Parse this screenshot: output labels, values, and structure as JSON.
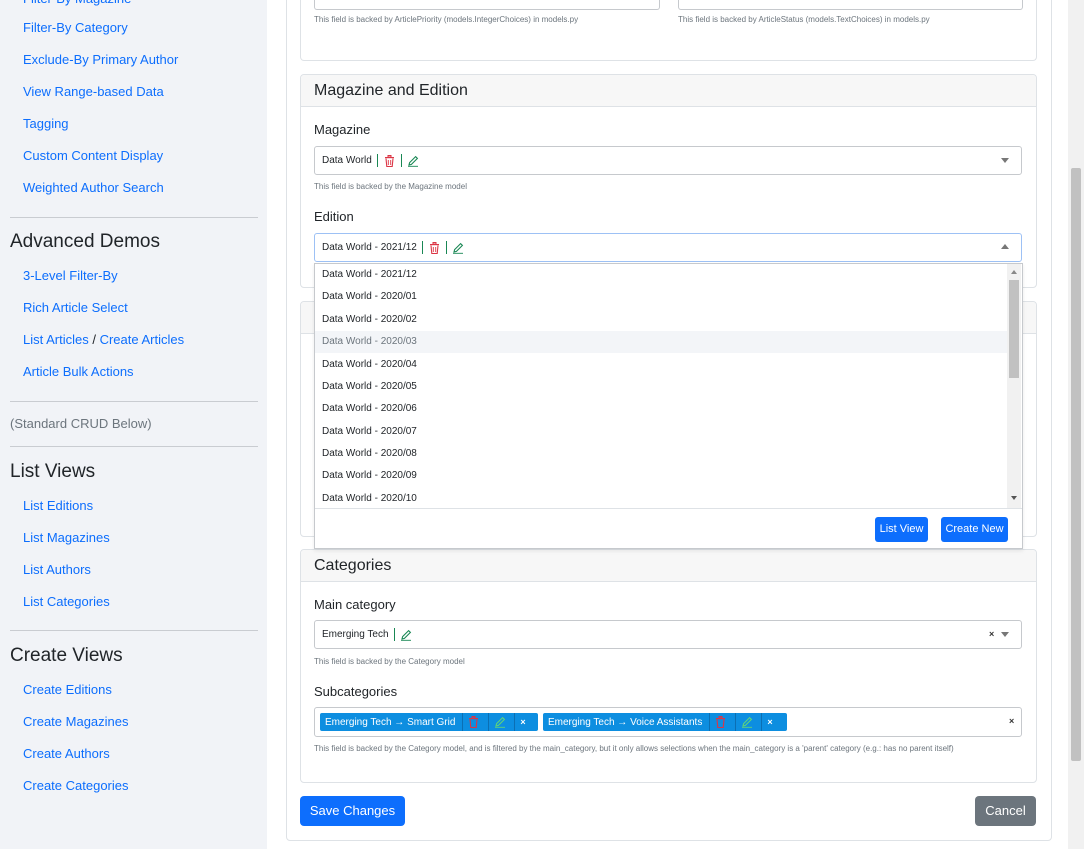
{
  "sidebar": {
    "top_links": [
      "Filter-By Category",
      "Exclude-By Primary Author",
      "View Range-based Data",
      "Tagging",
      "Custom Content Display",
      "Weighted Author Search"
    ],
    "advanced_heading": "Advanced Demos",
    "advanced_links": [
      "3-Level Filter-By",
      "Rich Article Select"
    ],
    "list_articles": "List Articles",
    "slash": " / ",
    "create_articles": "Create Articles",
    "bulk_actions": "Article Bulk Actions",
    "standard_crud": "(Standard CRUD Below)",
    "list_heading": "List Views",
    "list_links": [
      "List Editions",
      "List Magazines",
      "List Authors",
      "List Categories"
    ],
    "create_heading": "Create Views",
    "create_links": [
      "Create Editions",
      "Create Magazines",
      "Create Authors",
      "Create Categories"
    ]
  },
  "top_section": {
    "priority_help": "This field is backed by ArticlePriority (models.IntegerChoices) in models.py",
    "status_help": "This field is backed by ArticleStatus (models.TextChoices) in models.py"
  },
  "magazine_section": {
    "title": "Magazine and Edition",
    "magazine_label": "Magazine",
    "magazine_value": "Data World",
    "magazine_help": "This field is backed by the Magazine model",
    "edition_label": "Edition",
    "edition_value": "Data World - 2021/12"
  },
  "edition_dropdown": {
    "options": [
      "Data World - 2021/12",
      "Data World - 2020/01",
      "Data World - 2020/02",
      "Data World - 2020/03",
      "Data World - 2020/04",
      "Data World - 2020/05",
      "Data World - 2020/06",
      "Data World - 2020/07",
      "Data World - 2020/08",
      "Data World - 2020/09",
      "Data World - 2020/10"
    ],
    "highlighted_index": 3,
    "list_view_label": "List View",
    "create_new_label": "Create New"
  },
  "categories_section": {
    "title": "Categories",
    "main_label": "Main category",
    "main_value": "Emerging Tech",
    "main_help": "This field is backed by the Category model",
    "sub_label": "Subcategories",
    "sub_tags": [
      "Emerging Tech → Smart Grid",
      "Emerging Tech → Voice Assistants"
    ],
    "sub_help": "This field is backed by the Category model, and is filtered by the main_category, but it only allows selections when the main_category is a 'parent' category (e.g.: has no parent itself)"
  },
  "actions": {
    "save_label": "Save Changes",
    "cancel_label": "Cancel"
  },
  "colors": {
    "primary": "#0d6efd",
    "tag": "#0d8ee0",
    "delete": "#dc3545",
    "edit": "#198754",
    "cancel": "#6c757d"
  }
}
